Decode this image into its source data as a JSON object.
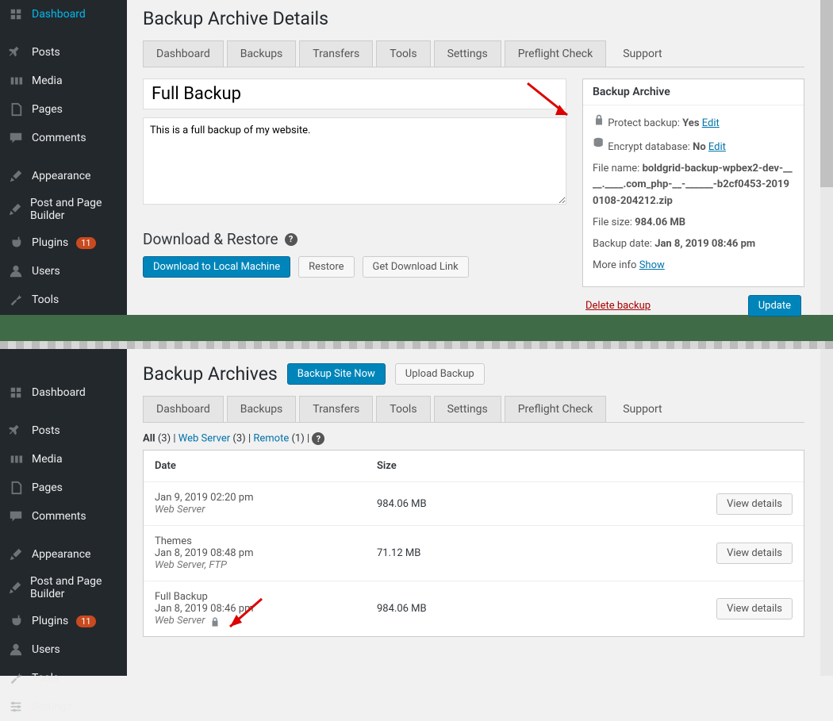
{
  "sidebar": {
    "items": [
      {
        "label": "Dashboard",
        "icon": "dash"
      },
      {
        "label": "Posts",
        "icon": "pin"
      },
      {
        "label": "Media",
        "icon": "media"
      },
      {
        "label": "Pages",
        "icon": "pages"
      },
      {
        "label": "Comments",
        "icon": "comments"
      },
      {
        "label": "Appearance",
        "icon": "brush"
      },
      {
        "label": "Post and Page Builder",
        "icon": "brush"
      },
      {
        "label": "Plugins",
        "icon": "plugin",
        "badge": "11"
      },
      {
        "label": "Users",
        "icon": "user"
      },
      {
        "label": "Tools",
        "icon": "wrench"
      },
      {
        "label": "Settings",
        "icon": "settings"
      }
    ]
  },
  "tabs": [
    "Dashboard",
    "Backups",
    "Transfers",
    "Tools",
    "Settings",
    "Preflight Check",
    "Support"
  ],
  "details": {
    "page_heading": "Backup Archive Details",
    "title_value": "Full Backup",
    "desc_value": "This is a full backup of my website.",
    "download_heading": "Download & Restore",
    "btn_download": "Download to Local Machine",
    "btn_restore": "Restore",
    "btn_getlink": "Get Download Link",
    "meta_heading": "Backup Archive",
    "protect_label": "Protect backup:",
    "protect_value": "Yes",
    "protect_edit": "Edit",
    "encrypt_label": "Encrypt database:",
    "encrypt_value": "No",
    "encrypt_edit": "Edit",
    "filename_label": "File name:",
    "filename_value": "boldgrid-backup-wpbex2-dev-____.____.com_php-__-______-b2cf0453-20190108-204212.zip",
    "filesize_label": "File size:",
    "filesize_value": "984.06 MB",
    "date_label": "Backup date:",
    "date_value": "Jan 8, 2019 08:46 pm",
    "moreinfo_label": "More info",
    "moreinfo_link": "Show",
    "delete_label": "Delete backup",
    "update_label": "Update"
  },
  "archives": {
    "page_heading": "Backup Archives",
    "btn_backup_now": "Backup Site Now",
    "btn_upload": "Upload Backup",
    "filters": {
      "all_label": "All",
      "all_count": "(3)",
      "web_label": "Web Server",
      "web_count": "(3)",
      "remote_label": "Remote",
      "remote_count": "(1)"
    },
    "headers": {
      "date": "Date",
      "size": "Size"
    },
    "btn_view": "View details",
    "rows": [
      {
        "title": "",
        "date": "Jan 9, 2019 02:20 pm",
        "loc": "Web Server",
        "size": "984.06 MB",
        "lock": false
      },
      {
        "title": "Themes",
        "date": "Jan 8, 2019 08:48 pm",
        "loc": "Web Server, FTP",
        "size": "71.12 MB",
        "lock": false
      },
      {
        "title": "Full Backup",
        "date": "Jan 8, 2019 08:46 pm",
        "loc": "Web Server",
        "size": "984.06 MB",
        "lock": true
      }
    ]
  }
}
